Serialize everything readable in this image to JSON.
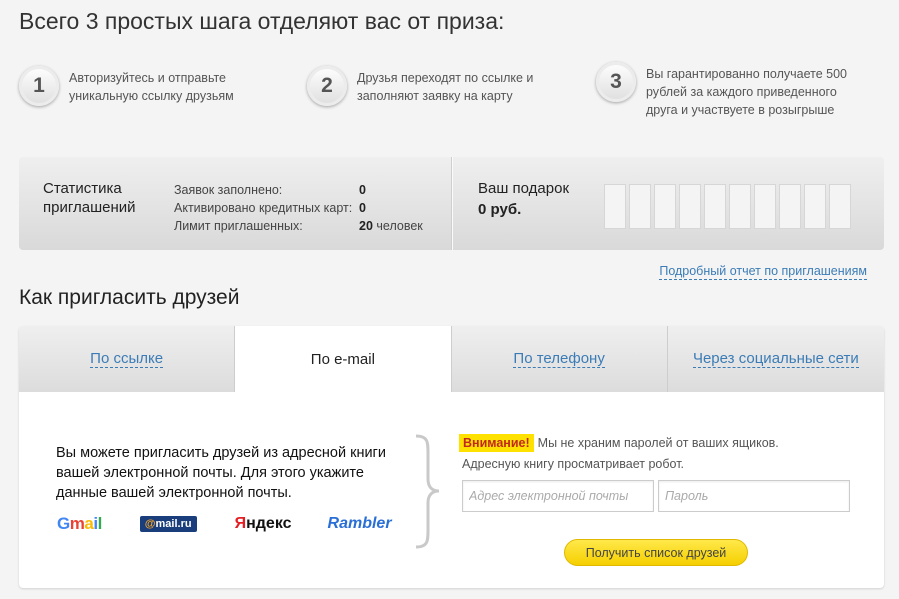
{
  "header": {
    "title": "Всего 3 простых шага отделяют вас от приза:"
  },
  "steps": [
    {
      "number": "1",
      "text": "Авторизуйтесь и отправьте уникальную ссылку друзьям"
    },
    {
      "number": "2",
      "text": "Друзья переходят по ссылке и заполняют заявку на карту"
    },
    {
      "number": "3",
      "text": "Вы гарантированно получаете 500 рублей за каждого приведенного друга и участвуете в розыгрыше"
    }
  ],
  "stats": {
    "title": "Статистика приглашений",
    "rows": [
      {
        "label": "Заявок заполнено:",
        "value": "0"
      },
      {
        "label": "Активировано кредитных карт:",
        "value": "0"
      },
      {
        "label": "Лимит приглашенных:",
        "value": "20",
        "unit": "человек"
      }
    ],
    "gift_label": "Ваш подарок",
    "gift_value": "0 руб.",
    "gift_cells_count": 10
  },
  "report_link": "Подробный отчет по приглашениям",
  "invite": {
    "title": "Как пригласить друзей",
    "tabs": [
      {
        "label": "По ссылке",
        "active": false
      },
      {
        "label": "По e-mail",
        "active": true
      },
      {
        "label": "По телефону",
        "active": false
      },
      {
        "label": "Через социальные сети",
        "active": false
      }
    ],
    "description": "Вы можете пригласить друзей из адресной книги вашей электронной почты. Для этого укажите данные вашей электронной почты.",
    "logos": {
      "gmail": "Gmail",
      "mail": "mail.ru",
      "yandex": "Яндекс",
      "rambler": "Rambler"
    },
    "attention_badge": "Внимание!",
    "attention_text": "Мы не храним паролей от ваших ящиков.",
    "attention_line2": "Адресную книгу просматривает робот.",
    "email_placeholder": "Адрес электронной почты",
    "password_placeholder": "Пароль",
    "submit_label": "Получить список друзей"
  }
}
